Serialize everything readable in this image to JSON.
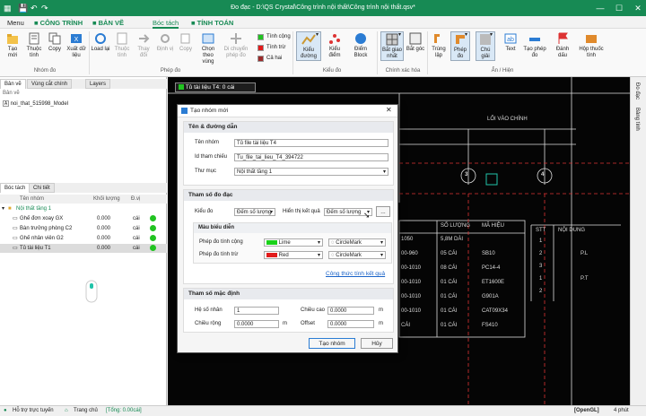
{
  "titlebar": {
    "title": "Đo đạc - D:\\QS Crystal\\Công trình nội thất\\Công trình nội thất.qsv*"
  },
  "menubar": {
    "menu": "Menu",
    "tabs": [
      "CÔNG TRÌNH",
      "BẢN VẼ",
      "Bóc tách",
      "TÍNH TOÁN"
    ]
  },
  "ribbon": {
    "buttons": [
      "Tạo mới",
      "Thuộc tính",
      "Copy",
      "Xuất dữ liệu",
      "Load lại",
      "Thuộc tính",
      "Thay đổi",
      "Định vị",
      "Copy",
      "Chọn theo vùng",
      "Di chuyển phép đo",
      "Kiểu đường",
      "Kiểu điểm",
      "Điểm Block",
      "Bắt giao nhất",
      "Bắt góc",
      "Trùng lập",
      "Phép đo",
      "Chú giải",
      "Text",
      "Tạo phép đo",
      "Đánh dấu",
      "Hộp thuốc tính"
    ],
    "checks": [
      "Tính cộng",
      "Tính trừ",
      "Cả hai"
    ],
    "groups": [
      "Nhóm đo",
      "Phép đo",
      "Kiểu đo",
      "Chính xác hóa",
      "Ẩn / Hiện"
    ]
  },
  "leftpane": {
    "tabs_top": [
      "Bản vẽ",
      "Vùng cắt chính",
      "Layers"
    ],
    "header": "Bản vẽ",
    "model": "noi_that_515998_Model",
    "tabs_bottom": [
      "Bóc tách",
      "Chi tiết"
    ],
    "cols": [
      "Tên nhóm",
      "Khối lượng",
      "Đ.vị",
      ""
    ],
    "group_name": "Nội thất tầng 1",
    "rows": [
      {
        "name": "Ghế đơn xoay GX",
        "qty": "0.000",
        "unit": "cái"
      },
      {
        "name": "Bàn trưởng phòng C2",
        "qty": "0.000",
        "unit": "cái"
      },
      {
        "name": "Ghế nhân viên G2",
        "qty": "0.000",
        "unit": "cái"
      },
      {
        "name": "Tủ tài liệu T1",
        "qty": "0.000",
        "unit": "cái"
      }
    ]
  },
  "canvas": {
    "tag": "Tủ tài liệu T4: 0 cái",
    "entry_label": "LỐI VÀO CHÍNH",
    "grid_nums": [
      "3",
      "4"
    ],
    "table1_head": [
      "SỐ LƯỢNG",
      "MÃ HIỆU"
    ],
    "table1_left": [
      "1050",
      "00-960",
      "00-1010",
      "00-1010",
      "00-1010",
      "00-1010",
      "CÁI"
    ],
    "table1_rows": [
      [
        "5,8M DÀI",
        ""
      ],
      [
        "05 CÁI",
        "SB10"
      ],
      [
        "08 CÁI",
        "PC14-4"
      ],
      [
        "01 CÁI",
        "ET1600E"
      ],
      [
        "01 CÁI",
        "G901A"
      ],
      [
        "01 CÁI",
        "CAT09X34"
      ],
      [
        "01 CÁI",
        "FS410"
      ]
    ],
    "table2_head": [
      "STT",
      "NỘI DUNG"
    ],
    "table2_rows": [
      [
        "1",
        ""
      ],
      [
        "2",
        "P.L"
      ],
      [
        "3",
        ""
      ],
      [
        "1",
        "P.T"
      ],
      [
        "2",
        ""
      ]
    ]
  },
  "dialog": {
    "title": "Tạo nhóm mới",
    "sec1": "Tên & đường dẫn",
    "name_label": "Tên nhóm",
    "name_value": "Tủ file tài liệu T4",
    "id_label": "Id tham chiếu",
    "id_value": "Tu_file_tai_lieu_T4_394722",
    "folder_label": "Thư mục",
    "folder_value": "Nội thất tầng 1",
    "sec2": "Tham số đo đạc",
    "kind_label": "Kiểu đo",
    "kind_value": "Đếm số lượng",
    "show_label": "Hiển thị kết quả",
    "show_value": "Đếm số lượng",
    "more_btn": "...",
    "color_sec": "Màu biểu diễn",
    "plus_label": "Phép đo tính cộng",
    "plus_color_name": "Lime",
    "plus_color": "#19d119",
    "plus_mark": "CircleMark",
    "minus_label": "Phép đo tính trừ",
    "minus_color_name": "Red",
    "minus_color": "#e21b1b",
    "minus_mark": "CircleMark",
    "formula_link": "Công thức tính kết quả",
    "sec3": "Tham số mặc định",
    "coef_label": "Hệ số nhân",
    "coef_value": "1",
    "height_label": "Chiều cao",
    "height_value": "0.0000",
    "width_label": "Chiều rộng",
    "width_value": "0.0000",
    "offset_label": "Offset",
    "offset_value": "0.0000",
    "unit_m": "m",
    "create_btn": "Tạo nhóm",
    "cancel_btn": "Hủy"
  },
  "rside": {
    "items": [
      "Đo đạc",
      "Bảng tính"
    ]
  },
  "statusbar": {
    "support": "Hỗ trợ trực tuyến",
    "home": "Trang chủ",
    "total": "[Tổng: 0.00cái]",
    "opengl": "[OpenGL]",
    "zoom": "4 phút"
  }
}
